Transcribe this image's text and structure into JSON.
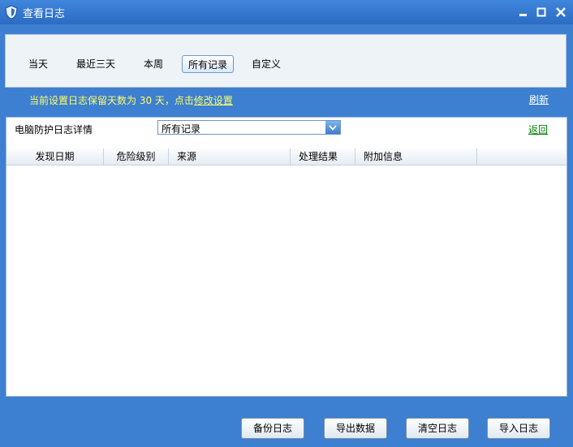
{
  "window": {
    "title": "查看日志",
    "controls": [
      "minimize-icon",
      "maximize-icon",
      "close-icon"
    ]
  },
  "tabs": [
    {
      "label": "当天",
      "active": false
    },
    {
      "label": "最近三天",
      "active": false
    },
    {
      "label": "本周",
      "active": false
    },
    {
      "label": "所有记录",
      "active": true
    },
    {
      "label": "自定义",
      "active": false
    }
  ],
  "info": {
    "text": "当前设置日志保留天数为 30 天，点击",
    "link": "修改设置",
    "refresh": "刷新"
  },
  "detail": {
    "label": "电脑防护日志详情",
    "filter_value": "所有记录",
    "back": "返回"
  },
  "table": {
    "columns": [
      "发现日期",
      "危险级别",
      "来源",
      "处理结果",
      "附加信息",
      ""
    ],
    "rows": []
  },
  "buttons": {
    "backup": "备份日志",
    "export": "导出数据",
    "clear": "清空日志",
    "import": "导入日志"
  },
  "colors": {
    "frame": "#3d7fd0",
    "accent_text": "#ffff66",
    "link_green": "#008000"
  }
}
